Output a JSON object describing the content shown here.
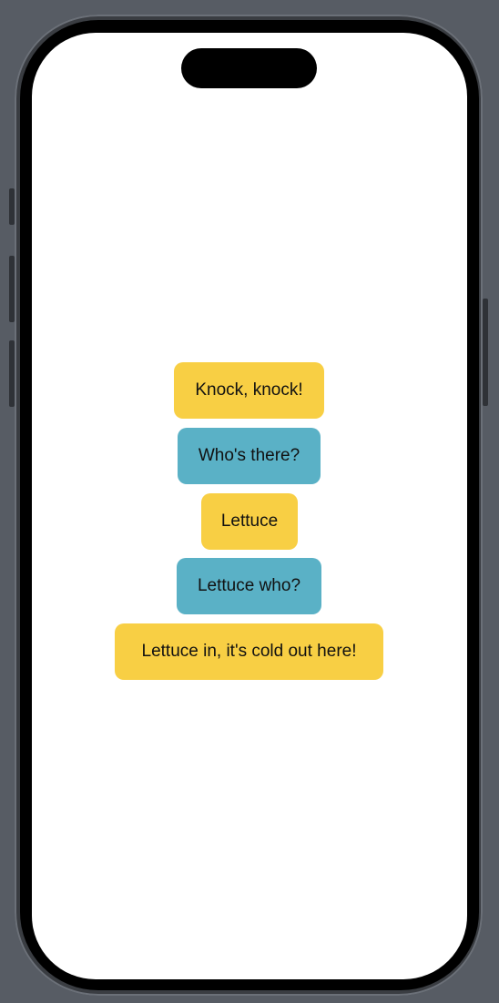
{
  "conversation": {
    "messages": [
      {
        "text": "Knock, knock!",
        "color": "#f8cf44"
      },
      {
        "text": "Who's there?",
        "color": "#5ab1c6"
      },
      {
        "text": "Lettuce",
        "color": "#f8cf44"
      },
      {
        "text": "Lettuce who?",
        "color": "#5ab1c6"
      },
      {
        "text": "Lettuce in, it's cold out here!",
        "color": "#f8cf44"
      }
    ]
  },
  "device": {
    "background": "#575c64",
    "screen_color": "#ffffff"
  }
}
